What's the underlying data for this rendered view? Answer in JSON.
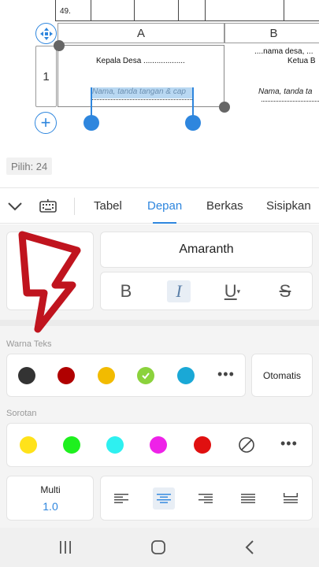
{
  "sheet": {
    "row_top_label": "49.",
    "col_a": "A",
    "col_b": "B",
    "row_label": "1",
    "cell_a_line1": "Kepala Desa ...................",
    "cell_a_placeholder": "Nama, tanda tangan & cap",
    "cell_b_line1": "....nama desa, ...",
    "cell_b_line2": "Ketua B",
    "cell_b_placeholder": "Nama, tanda ta",
    "selection_count": "Pilih: 24"
  },
  "tabs": [
    {
      "label": "Tabel",
      "active": false
    },
    {
      "label": "Depan",
      "active": true
    },
    {
      "label": "Berkas",
      "active": false
    },
    {
      "label": "Sisipkan",
      "active": false
    }
  ],
  "font": {
    "name": "Amaranth",
    "bold_label": "B",
    "italic_label": "I",
    "underline_label": "U",
    "strike_label": "S"
  },
  "text_color": {
    "label": "Warna Teks",
    "swatches": [
      "#333333",
      "#b00000",
      "#f2bb00",
      "#8bd23c",
      "#1aa8d6"
    ],
    "selected_index": 3,
    "auto_label": "Otomatis"
  },
  "highlight": {
    "label": "Sorotan",
    "swatches": [
      "#ffe21a",
      "#1ef01e",
      "#2ef0f0",
      "#ee22e8",
      "#e01010"
    ]
  },
  "spacing": {
    "title": "Multi",
    "value": "1.0"
  },
  "colors": {
    "accent": "#2e86de",
    "arrow": "#c0141e"
  }
}
